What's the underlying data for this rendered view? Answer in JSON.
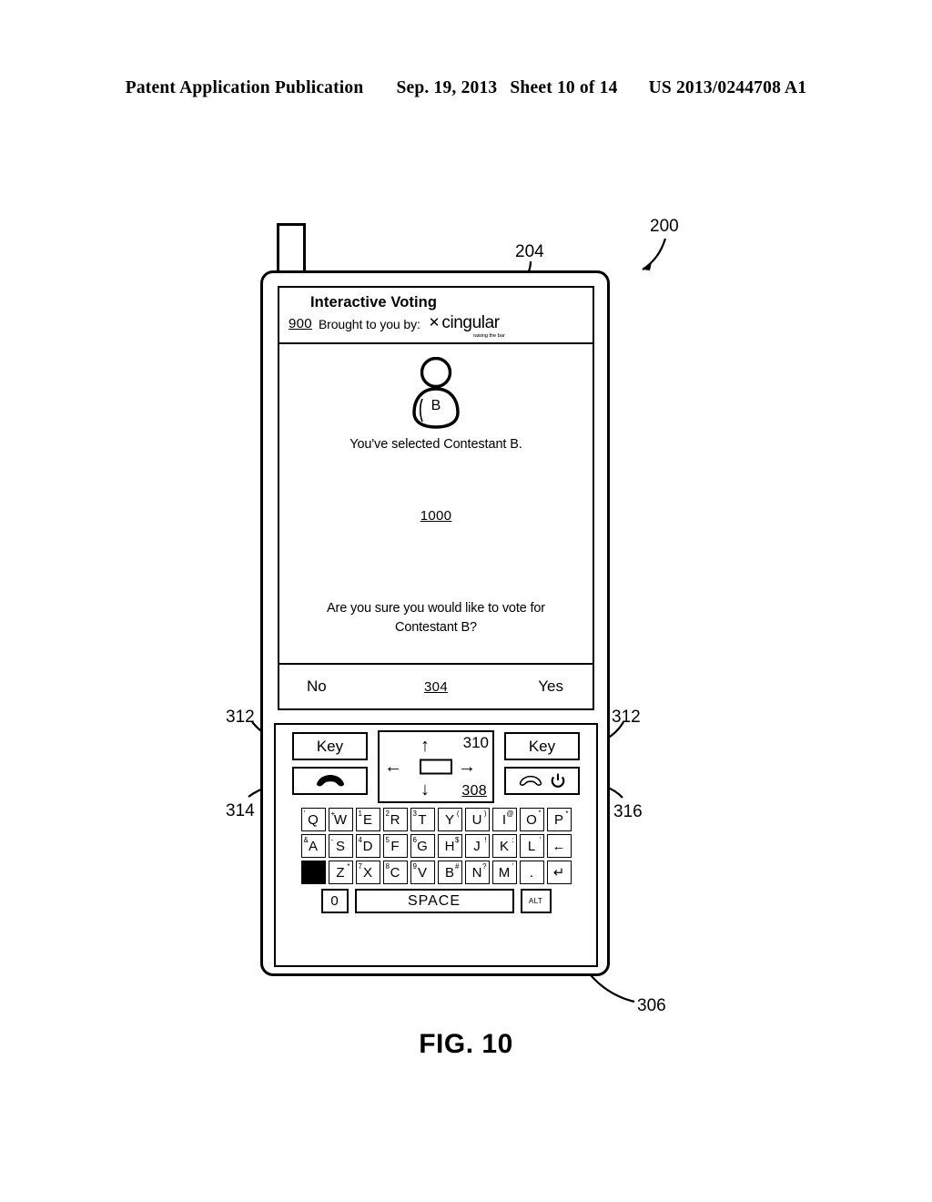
{
  "header": {
    "publication": "Patent Application Publication",
    "date": "Sep. 19, 2013",
    "sheet": "Sheet 10 of 14",
    "patent_number": "US 2013/0244708 A1"
  },
  "figure": {
    "caption": "FIG. 10",
    "reference_numerals": {
      "device": "200",
      "display": "204",
      "keypad": "306",
      "navigation_pad": "310",
      "navigation_label": "308",
      "softkey_bar": "304",
      "screen_id": "900",
      "content_id": "1000",
      "key_left": "312",
      "key_right": "312",
      "send_key": "314",
      "end_key": "316"
    }
  },
  "device": {
    "screen": {
      "app_title": "Interactive Voting",
      "screen_ref": "900",
      "brought_label": "Brought to you by:",
      "logo": {
        "mark": "✕",
        "word": "cingular",
        "tagline": "raising the bar"
      },
      "avatar": {
        "letter": "B",
        "icon": "person-avatar-icon"
      },
      "selected_message": "You've selected Contestant B.",
      "content_ref": "1000",
      "confirm_question_line1": "Are you sure you would like to vote for",
      "confirm_question_line2": "Contestant B?",
      "softkeys": {
        "left": "No",
        "center_ref": "304",
        "right": "Yes"
      }
    },
    "controls": {
      "key_left_label": "Key",
      "key_right_label": "Key",
      "send_icon": "phone-handset-send-icon",
      "end_icon": "phone-handset-end-icon",
      "power_icon": "power-icon",
      "nav_up": "↑",
      "nav_down": "↓",
      "nav_left": "←",
      "nav_right": "→",
      "nav_ref": "310",
      "nav_label_ref": "308"
    },
    "keyboard": {
      "row1": [
        {
          "key": "Q",
          "sup": "'",
          "sup_side": "left"
        },
        {
          "key": "W",
          "sup": "+",
          "sup_side": "left"
        },
        {
          "key": "E",
          "sup": "1",
          "sup_side": "left"
        },
        {
          "key": "R",
          "sup": "2",
          "sup_side": "left"
        },
        {
          "key": "T",
          "sup": "3",
          "sup_side": "left"
        },
        {
          "key": "Y",
          "sup": "(",
          "sup_side": "right"
        },
        {
          "key": "U",
          "sup": ")",
          "sup_side": "right"
        },
        {
          "key": "I",
          "sup": "@",
          "sup_side": "right"
        },
        {
          "key": "O",
          "sup": "\"",
          "sup_side": "right"
        },
        {
          "key": "P",
          "sup": "*",
          "sup_side": "right"
        }
      ],
      "row2": [
        {
          "key": "A",
          "sup": "&",
          "sup_side": "left"
        },
        {
          "key": "S",
          "sup": "-",
          "sup_side": "left"
        },
        {
          "key": "D",
          "sup": "4",
          "sup_side": "left"
        },
        {
          "key": "F",
          "sup": "5",
          "sup_side": "left"
        },
        {
          "key": "G",
          "sup": "6",
          "sup_side": "left"
        },
        {
          "key": "H",
          "sup": "$",
          "sup_side": "right"
        },
        {
          "key": "J",
          "sup": "!",
          "sup_side": "right"
        },
        {
          "key": "K",
          "sup": ":",
          "sup_side": "right"
        },
        {
          "key": "L",
          "sup": "'",
          "sup_side": "right"
        },
        {
          "key": "←",
          "sup": "",
          "sup_side": "none"
        }
      ],
      "row3": [
        {
          "key": "",
          "sup": "",
          "sup_side": "shift"
        },
        {
          "key": "Z",
          "sup": "*",
          "sup_side": "right"
        },
        {
          "key": "X",
          "sup": "7",
          "sup_side": "left"
        },
        {
          "key": "C",
          "sup": "8",
          "sup_side": "left"
        },
        {
          "key": "V",
          "sup": "9",
          "sup_side": "left"
        },
        {
          "key": "B",
          "sup": "#",
          "sup_side": "right"
        },
        {
          "key": "N",
          "sup": "?",
          "sup_side": "right"
        },
        {
          "key": "M",
          "sup": "'",
          "sup_side": "right"
        },
        {
          "key": ".",
          "sup": "",
          "sup_side": "none"
        },
        {
          "key": "↵",
          "sup": "",
          "sup_side": "none"
        }
      ],
      "row4": {
        "zero": "0",
        "space": "SPACE",
        "alt": "ALT"
      }
    }
  }
}
